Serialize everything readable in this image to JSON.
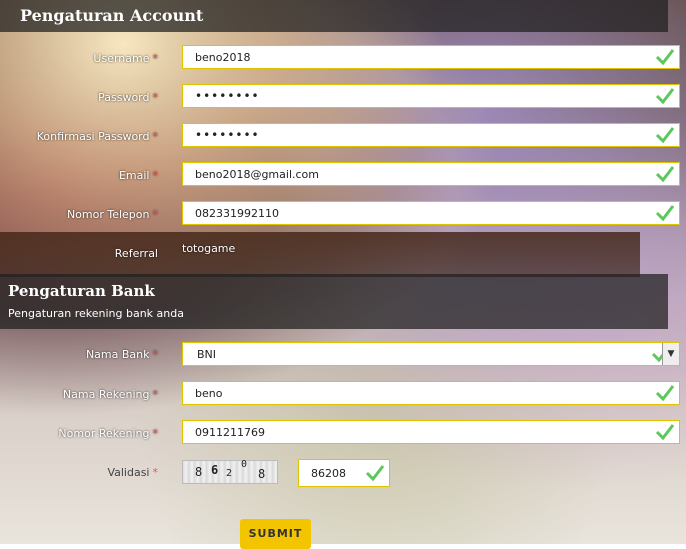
{
  "account_section": {
    "title": "Pengaturan Account",
    "fields": [
      {
        "label": "Username",
        "value": "beno2018"
      },
      {
        "label": "Password",
        "value": "••••••••"
      },
      {
        "label": "Konfirmasi Password",
        "value": "••••••••"
      },
      {
        "label": "Email",
        "value": "beno2018@gmail.com"
      },
      {
        "label": "Nomor Telepon",
        "value": "082331992110"
      }
    ],
    "referral": {
      "label": "Referral",
      "value": "totogame"
    }
  },
  "bank_section": {
    "title": "Pengaturan Bank",
    "subtitle": "Pengaturan rekening bank anda",
    "fields": [
      {
        "label": "Nama Bank",
        "value": "BNI"
      },
      {
        "label": "Nama Rekening",
        "value": "beno"
      },
      {
        "label": "Nomor Rekening",
        "value": "0911211769"
      }
    ],
    "validation": {
      "label": "Validasi",
      "captcha_chars": [
        "8",
        "6",
        "2",
        "0",
        "8"
      ],
      "value": "86208"
    }
  },
  "required_mark": "*",
  "submit_label": "SUBMIT",
  "colors": {
    "accent": "#f2c500",
    "field_border": "#e0c400",
    "check": "#5cc85c",
    "required": "#ff4a4a"
  },
  "icons": {
    "valid": "check-icon",
    "dropdown": "chevron-down-icon"
  }
}
